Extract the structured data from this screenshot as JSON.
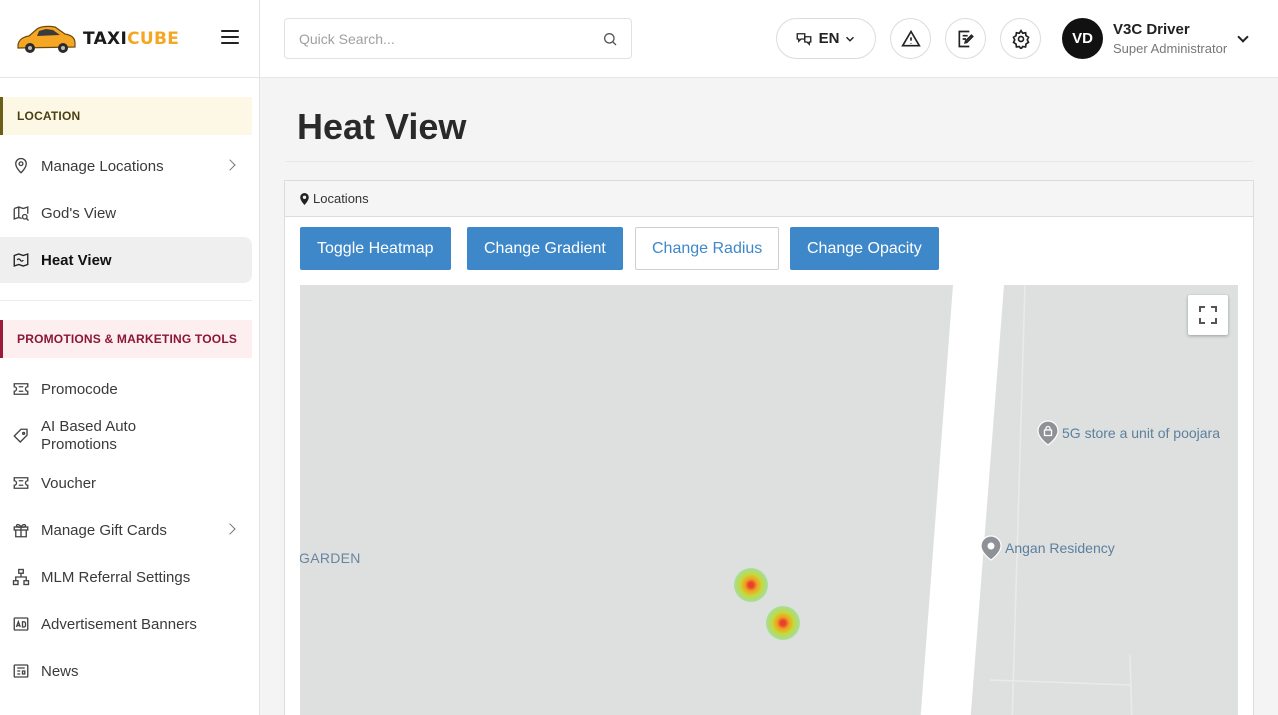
{
  "brand": {
    "name_part1": "TAXI",
    "name_part2": "CUBE"
  },
  "search": {
    "placeholder": "Quick Search..."
  },
  "header": {
    "language": "EN",
    "user": {
      "initials": "VD",
      "name": "V3C Driver",
      "role": "Super Administrator"
    }
  },
  "sidebar": {
    "location_section": "LOCATION",
    "location_items": [
      {
        "label": "Manage Locations",
        "icon": "map-pin-icon",
        "has_submenu": true
      },
      {
        "label": "God's View",
        "icon": "map-search-icon",
        "has_submenu": false
      },
      {
        "label": "Heat View",
        "icon": "heat-map-icon",
        "has_submenu": false,
        "active": true
      }
    ],
    "promo_section": "PROMOTIONS & MARKETING TOOLS",
    "promo_items": [
      {
        "label": "Promocode",
        "icon": "ticket-icon"
      },
      {
        "label": "AI Based Auto Promotions",
        "icon": "tag-icon"
      },
      {
        "label": "Voucher",
        "icon": "voucher-icon"
      },
      {
        "label": "Manage Gift Cards",
        "icon": "gift-icon",
        "has_submenu": true
      },
      {
        "label": "MLM Referral Settings",
        "icon": "hierarchy-icon"
      },
      {
        "label": "Advertisement Banners",
        "icon": "ad-icon"
      },
      {
        "label": "News",
        "icon": "news-icon"
      }
    ]
  },
  "main": {
    "title": "Heat View",
    "card_title": "Locations",
    "buttons": {
      "toggle_heatmap": "Toggle Heatmap",
      "change_gradient": "Change Gradient",
      "change_radius": "Change Radius",
      "change_opacity": "Change Opacity"
    },
    "map": {
      "labels": {
        "garden": "GARDEN",
        "store": "5G store a unit of poojara",
        "residency": "Angan Residency"
      },
      "heat_points": 2
    }
  },
  "colors": {
    "primary": "#3e88c9",
    "brand_accent": "#f5a623",
    "location_accent": "#6b5e1a",
    "promo_accent": "#9b1b3a"
  }
}
